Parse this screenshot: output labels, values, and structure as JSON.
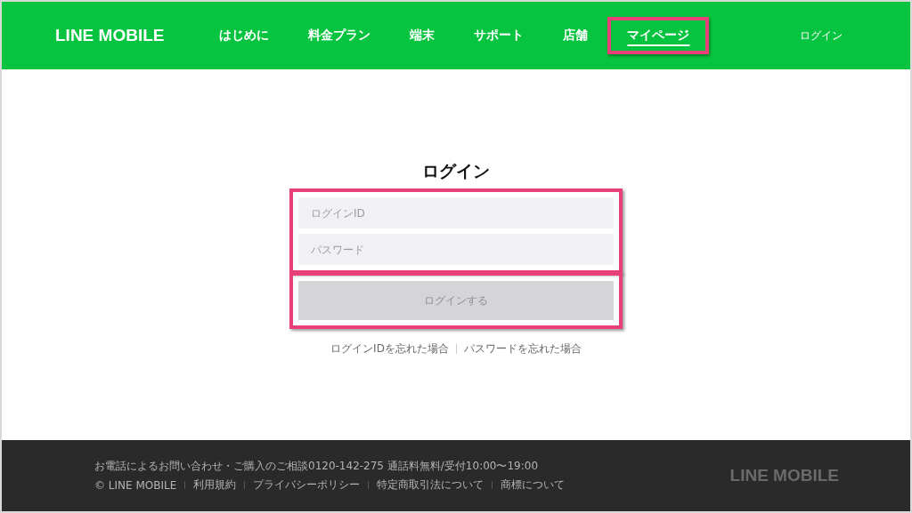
{
  "header": {
    "logo": "LINE MOBILE",
    "nav": [
      {
        "label": "はじめに",
        "selected": false,
        "highlighted": false
      },
      {
        "label": "料金プラン",
        "selected": false,
        "highlighted": false
      },
      {
        "label": "端末",
        "selected": false,
        "highlighted": false
      },
      {
        "label": "サポート",
        "selected": false,
        "highlighted": false
      },
      {
        "label": "店舗",
        "selected": false,
        "highlighted": false
      },
      {
        "label": "マイページ",
        "selected": true,
        "highlighted": true
      }
    ],
    "login_link": "ログイン"
  },
  "login": {
    "title": "ログイン",
    "fields_highlighted": true,
    "fields": [
      {
        "placeholder": "ログインID"
      },
      {
        "placeholder": "パスワード"
      }
    ],
    "button": {
      "label": "ログインする",
      "disabled": true,
      "highlighted": true
    },
    "links": [
      "ログインIDを忘れた場合",
      "パスワードを忘れた場合"
    ]
  },
  "footer": {
    "contact": "お電話によるお問い合わせ・ご購入のご相談0120-142-275 通話料無料/受付10:00〜19:00",
    "links": [
      "© LINE MOBILE",
      "利用規約",
      "プライバシーポリシー",
      "特定商取引法について",
      "商標について"
    ],
    "logo": "LINE MOBILE"
  }
}
